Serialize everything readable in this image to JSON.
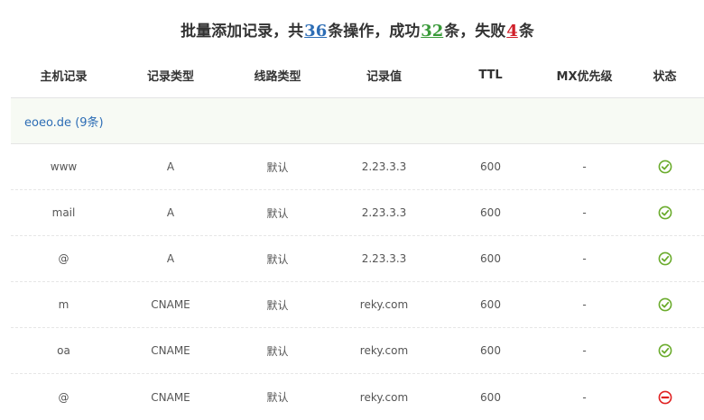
{
  "summary": {
    "prefix": "批量添加记录，共",
    "total": "36",
    "mid1": "条操作，成功",
    "success": "32",
    "mid2": "条，失败",
    "failed": "4",
    "suffix": "条"
  },
  "columns": {
    "host": "主机记录",
    "type": "记录类型",
    "line": "线路类型",
    "value": "记录值",
    "ttl": "TTL",
    "mx": "MX优先级",
    "status": "状态"
  },
  "group": {
    "label": "eoeo.de (9条)"
  },
  "rows": [
    {
      "host": "www",
      "type": "A",
      "line": "默认",
      "value": "2.23.3.3",
      "ttl": "600",
      "mx": "-",
      "status": "success"
    },
    {
      "host": "mail",
      "type": "A",
      "line": "默认",
      "value": "2.23.3.3",
      "ttl": "600",
      "mx": "-",
      "status": "success"
    },
    {
      "host": "@",
      "type": "A",
      "line": "默认",
      "value": "2.23.3.3",
      "ttl": "600",
      "mx": "-",
      "status": "success"
    },
    {
      "host": "m",
      "type": "CNAME",
      "line": "默认",
      "value": "reky.com",
      "ttl": "600",
      "mx": "-",
      "status": "success"
    },
    {
      "host": "oa",
      "type": "CNAME",
      "line": "默认",
      "value": "reky.com",
      "ttl": "600",
      "mx": "-",
      "status": "success"
    },
    {
      "host": "@",
      "type": "CNAME",
      "line": "默认",
      "value": "reky.com",
      "ttl": "600",
      "mx": "-",
      "status": "failed"
    }
  ],
  "colors": {
    "success": "#6aab2c",
    "failed": "#e02020",
    "link": "#2d6db5"
  },
  "icons": {
    "success": "check-circle-icon",
    "failed": "minus-circle-icon"
  }
}
